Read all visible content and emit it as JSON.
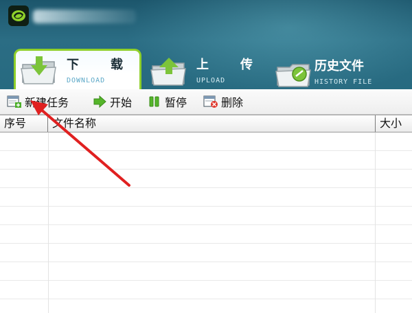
{
  "tabs": [
    {
      "cn": "下　载",
      "en": "DOWNLOAD",
      "active": true
    },
    {
      "cn": "上　传",
      "en": "UPLOAD",
      "active": false
    },
    {
      "cn": "历史文件",
      "en": "HISTORY FILE",
      "active": false
    }
  ],
  "toolbar": {
    "new_task_label": "新建任务",
    "start_label": "开始",
    "pause_label": "暂停",
    "delete_label": "删除"
  },
  "table": {
    "columns": [
      "序号",
      "文件名称",
      "大小"
    ],
    "rows": []
  },
  "colors": {
    "header_bg": "#276a80",
    "active_tab_border": "#8fcf2a",
    "annotation_arrow": "#e02020"
  },
  "icons": {
    "app_logo": "app-logo-icon",
    "download_tab": "download-folder-icon",
    "upload_tab": "upload-folder-icon",
    "history_tab": "history-folder-icon",
    "new_task": "new-task-icon",
    "start": "play-icon",
    "pause": "pause-icon",
    "delete": "delete-icon"
  }
}
